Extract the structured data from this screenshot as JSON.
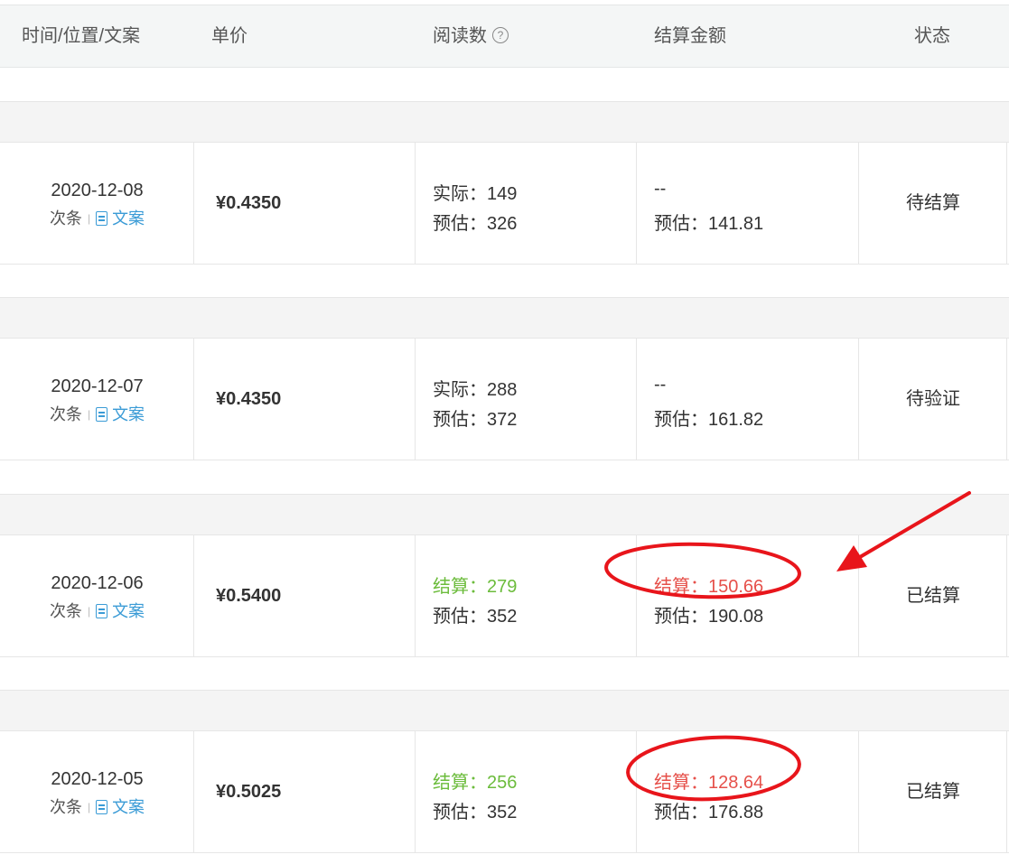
{
  "header": {
    "col_time": "时间/位置/文案",
    "col_price": "单价",
    "col_reads": "阅读数",
    "col_amount": "结算金额",
    "col_status": "状态"
  },
  "rows": [
    {
      "date": "2020-12-08",
      "position": "次条",
      "doc_label": "文案",
      "price": "¥0.4350",
      "reads_line1": "实际：149",
      "reads_line2": "预估：326",
      "amount_line1": "--",
      "amount_line2": "预估：141.81",
      "status": "待结算"
    },
    {
      "date": "2020-12-07",
      "position": "次条",
      "doc_label": "文案",
      "price": "¥0.4350",
      "reads_line1": "实际：288",
      "reads_line2": "预估：372",
      "amount_line1": "--",
      "amount_line2": "预估：161.82",
      "status": "待验证"
    },
    {
      "date": "2020-12-06",
      "position": "次条",
      "doc_label": "文案",
      "price": "¥0.5400",
      "reads_line1": "结算：279",
      "reads_line2": "预估：352",
      "amount_line1": "结算：150.66",
      "amount_line2": "预估：190.08",
      "status": "已结算"
    },
    {
      "date": "2020-12-05",
      "position": "次条",
      "doc_label": "文案",
      "price": "¥0.5025",
      "reads_line1": "结算：256",
      "reads_line2": "预估：352",
      "amount_line1": "结算：128.64",
      "amount_line2": "预估：176.88",
      "status": "已结算"
    }
  ],
  "icons": {
    "help": "help-circle-icon",
    "doc": "document-icon"
  },
  "colors": {
    "settled_reads": "#6cbc3c",
    "settled_amount": "#e6504a",
    "annotation": "#e8151b",
    "link": "#3a9bd6"
  }
}
